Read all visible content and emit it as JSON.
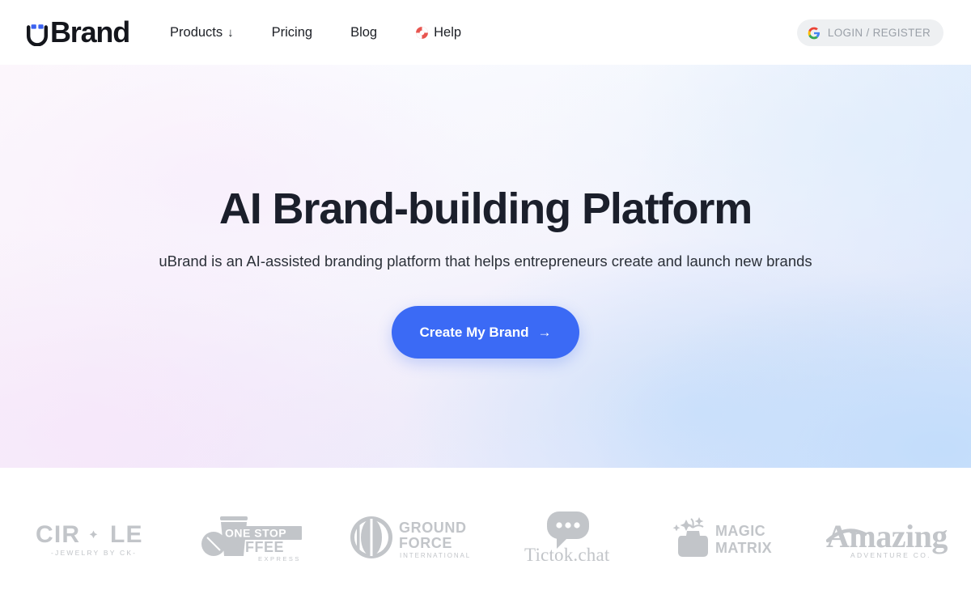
{
  "header": {
    "logo": {
      "name": "uBrand",
      "mark_icon": "ubrand-u-smiley-icon",
      "text": "Brand",
      "dot_color": "#3b62f0",
      "text_color": "#14161c"
    },
    "nav": [
      {
        "label": "Products",
        "icon": "chevron-down-arrow-icon",
        "arrow": "↓",
        "has_arrow": true
      },
      {
        "label": "Pricing",
        "has_arrow": false
      },
      {
        "label": "Blog",
        "has_arrow": false
      },
      {
        "label": "Help",
        "icon": "lifebuoy-icon",
        "has_arrow": false,
        "has_icon": true
      }
    ],
    "login_button": {
      "label": "LOGIN / REGISTER",
      "icon": "google-g-icon",
      "background": "#eef0f2",
      "text_color": "#9aa0a8"
    }
  },
  "hero": {
    "title": "AI Brand-building Platform",
    "subtitle": "uBrand is an AI-assisted branding platform that helps entrepreneurs create and launch new brands",
    "cta": {
      "label": "Create My Brand",
      "arrow": "→",
      "icon": "arrow-right-icon",
      "background": "#3b6af5",
      "text_color": "#ffffff"
    },
    "background_colors": {
      "top": "#fdfeff",
      "left_bottom": "#f3e0fa",
      "right_bottom": "#b2d3fa",
      "mid": "#eeeaf9"
    }
  },
  "clients": {
    "logo_color": "#c2c5c9",
    "items": [
      {
        "name": "circle-jewelry",
        "title": "CIRCLE",
        "tagline": "-JEWELRY BY CK-",
        "icon": "crescent-moon-star-icon"
      },
      {
        "name": "one-stop-coffee",
        "title_line1": "ONE STOP",
        "title_line2": "COFFEE",
        "tagline": "EXPRESS",
        "icon": "coffee-cup-bean-icon"
      },
      {
        "name": "ground-force",
        "title_line1": "GROUND",
        "title_line2": "FORCE",
        "tagline": "INTERNATIONAL",
        "icon": "circle-emblem-icon"
      },
      {
        "name": "tictok-chat",
        "title": "Tictok.chat",
        "icon": "speech-bubble-dots-icon"
      },
      {
        "name": "magic-matrix",
        "title_line1": "MAGIC",
        "title_line2": "MATRIX",
        "icon": "magic-hat-sparkles-icon"
      },
      {
        "name": "amazing-adventure",
        "title": "Amazing",
        "tagline": "ADVENTURE CO.",
        "icon": "swoosh-icon"
      }
    ]
  }
}
